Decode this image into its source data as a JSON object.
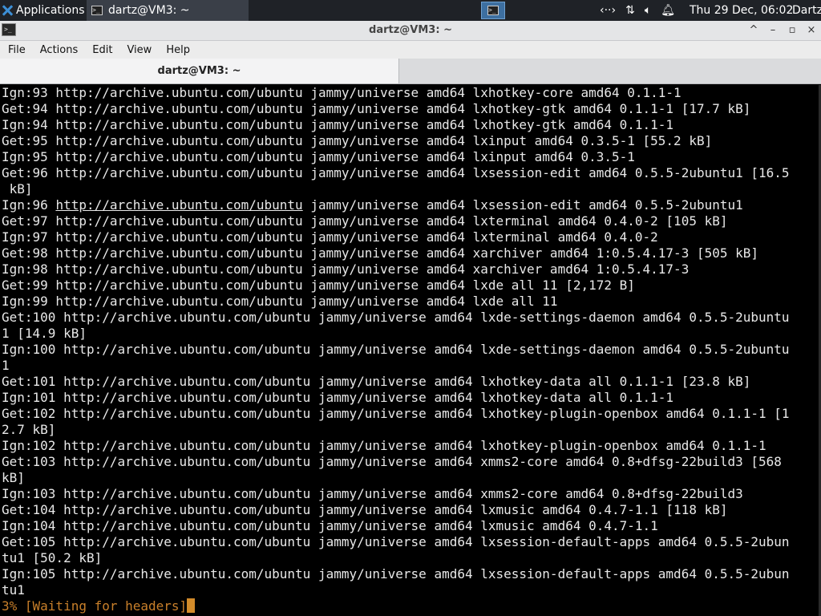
{
  "panel": {
    "applications_label": "Applications",
    "task_label": "dartz@VM3: ~",
    "tray_icons": [
      "network-icon",
      "transfer-icon",
      "volume-icon",
      "bell-icon"
    ],
    "clock": "Thu 29 Dec, 06:02",
    "user": "Dartz"
  },
  "window": {
    "title": "dartz@VM3: ~",
    "controls": [
      "^",
      "–",
      "▫",
      "×"
    ]
  },
  "menu": [
    "File",
    "Actions",
    "Edit",
    "View",
    "Help"
  ],
  "tab": {
    "label": "dartz@VM3: ~"
  },
  "terminal": {
    "lines": [
      "Ign:93 http://archive.ubuntu.com/ubuntu jammy/universe amd64 lxhotkey-core amd64 0.1.1-1",
      "Get:94 http://archive.ubuntu.com/ubuntu jammy/universe amd64 lxhotkey-gtk amd64 0.1.1-1 [17.7 kB]",
      "Ign:94 http://archive.ubuntu.com/ubuntu jammy/universe amd64 lxhotkey-gtk amd64 0.1.1-1",
      "Get:95 http://archive.ubuntu.com/ubuntu jammy/universe amd64 lxinput amd64 0.3.5-1 [55.2 kB]",
      "Ign:95 http://archive.ubuntu.com/ubuntu jammy/universe amd64 lxinput amd64 0.3.5-1",
      "Get:96 http://archive.ubuntu.com/ubuntu jammy/universe amd64 lxsession-edit amd64 0.5.5-2ubuntu1 [16.5",
      " kB]",
      "Ign:96 http://archive.ubuntu.com/ubuntu jammy/universe amd64 lxsession-edit amd64 0.5.5-2ubuntu1",
      "Get:97 http://archive.ubuntu.com/ubuntu jammy/universe amd64 lxterminal amd64 0.4.0-2 [105 kB]",
      "Ign:97 http://archive.ubuntu.com/ubuntu jammy/universe amd64 lxterminal amd64 0.4.0-2",
      "Get:98 http://archive.ubuntu.com/ubuntu jammy/universe amd64 xarchiver amd64 1:0.5.4.17-3 [505 kB]",
      "Ign:98 http://archive.ubuntu.com/ubuntu jammy/universe amd64 xarchiver amd64 1:0.5.4.17-3",
      "Get:99 http://archive.ubuntu.com/ubuntu jammy/universe amd64 lxde all 11 [2,172 B]",
      "Ign:99 http://archive.ubuntu.com/ubuntu jammy/universe amd64 lxde all 11",
      "Get:100 http://archive.ubuntu.com/ubuntu jammy/universe amd64 lxde-settings-daemon amd64 0.5.5-2ubuntu",
      "1 [14.9 kB]",
      "Ign:100 http://archive.ubuntu.com/ubuntu jammy/universe amd64 lxde-settings-daemon amd64 0.5.5-2ubuntu",
      "1",
      "Get:101 http://archive.ubuntu.com/ubuntu jammy/universe amd64 lxhotkey-data all 0.1.1-1 [23.8 kB]",
      "Ign:101 http://archive.ubuntu.com/ubuntu jammy/universe amd64 lxhotkey-data all 0.1.1-1",
      "Get:102 http://archive.ubuntu.com/ubuntu jammy/universe amd64 lxhotkey-plugin-openbox amd64 0.1.1-1 [1",
      "2.7 kB]",
      "Ign:102 http://archive.ubuntu.com/ubuntu jammy/universe amd64 lxhotkey-plugin-openbox amd64 0.1.1-1",
      "Get:103 http://archive.ubuntu.com/ubuntu jammy/universe amd64 xmms2-core amd64 0.8+dfsg-22build3 [568",
      "kB]",
      "Ign:103 http://archive.ubuntu.com/ubuntu jammy/universe amd64 xmms2-core amd64 0.8+dfsg-22build3",
      "Get:104 http://archive.ubuntu.com/ubuntu jammy/universe amd64 lxmusic amd64 0.4.7-1.1 [118 kB]",
      "Ign:104 http://archive.ubuntu.com/ubuntu jammy/universe amd64 lxmusic amd64 0.4.7-1.1",
      "Get:105 http://archive.ubuntu.com/ubuntu jammy/universe amd64 lxsession-default-apps amd64 0.5.5-2ubun",
      "tu1 [50.2 kB]",
      "Ign:105 http://archive.ubuntu.com/ubuntu jammy/universe amd64 lxsession-default-apps amd64 0.5.5-2ubun",
      "tu1"
    ],
    "status": "3% [Waiting for headers]"
  },
  "colors": {
    "status": "#c87f2a",
    "cursor": "#d28b2a",
    "text": "#e8e8e8"
  }
}
